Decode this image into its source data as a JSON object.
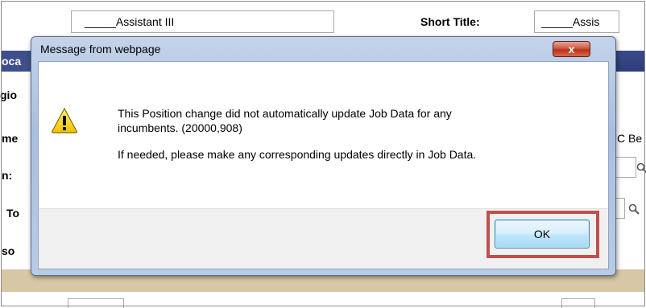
{
  "background_form": {
    "position_title_value": "_____Assistant III",
    "short_title_label": "Short Title:",
    "short_title_value": "_____Assis",
    "section_header_partial": "oca",
    "row_labels": [
      "gio",
      "me",
      "n:",
      "To",
      "so"
    ],
    "right_partial_label": "C Be"
  },
  "dialog": {
    "title": "Message from webpage",
    "close_label": "x",
    "message_line1": "This Position change did not automatically update Job Data for any",
    "message_line2": "incumbents. (20000,908)",
    "message_line3": "If needed, please make any corresponding updates directly in Job Data.",
    "ok_label": "OK"
  },
  "colors": {
    "highlight": "#c0504d",
    "title_bar": "#b5c8e5",
    "header_band": "#3e4f8c",
    "tan_band": "#d8c7a6"
  },
  "icons": {
    "warning": "warning-icon",
    "lookup": "magnifier-icon"
  }
}
